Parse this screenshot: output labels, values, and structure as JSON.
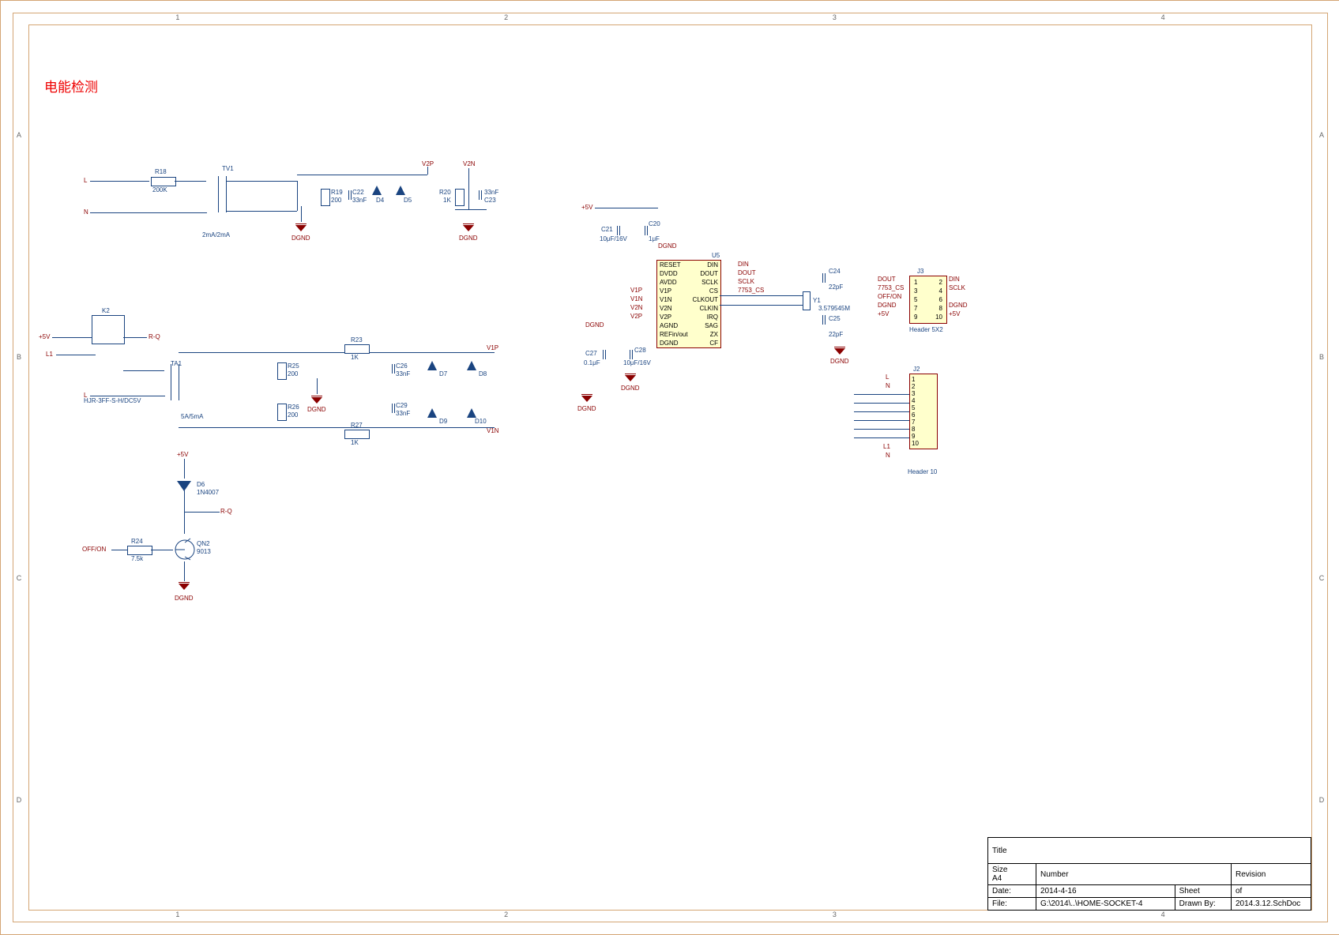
{
  "title_cn": "电能检测",
  "frame": {
    "cols": [
      "1",
      "2",
      "3",
      "4"
    ],
    "rows": [
      "A",
      "B",
      "C",
      "D"
    ]
  },
  "nets": {
    "L": "L",
    "N": "N",
    "L1": "L1",
    "V2P": "V2P",
    "V2N": "V2N",
    "V1P": "V1P",
    "V1N": "V1N",
    "p5V": "+5V",
    "DGND": "DGND",
    "OFFON": "OFF/ON",
    "RQ": "R-Q",
    "DIN": "DIN",
    "DOUT": "DOUT",
    "SCLK": "SCLK",
    "CS7753": "7753_CS"
  },
  "components": {
    "R18": {
      "ref": "R18",
      "val": "200K"
    },
    "R19": {
      "ref": "R19",
      "val": "200"
    },
    "R20": {
      "ref": "R20",
      "val": "1K"
    },
    "R23": {
      "ref": "R23",
      "val": "1K"
    },
    "R24": {
      "ref": "R24",
      "val": "7.5k"
    },
    "R25": {
      "ref": "R25",
      "val": "200"
    },
    "R26": {
      "ref": "R26",
      "val": "200"
    },
    "R27": {
      "ref": "R27",
      "val": "1K"
    },
    "C20": {
      "ref": "C20",
      "val": "1μF"
    },
    "C21": {
      "ref": "C21",
      "val": "10μF/16V"
    },
    "C22": {
      "ref": "C22",
      "val": "33nF"
    },
    "C23": {
      "ref": "C23",
      "val": "33nF"
    },
    "C24": {
      "ref": "C24",
      "val": "22pF"
    },
    "C25": {
      "ref": "C25",
      "val": "22pF"
    },
    "C26": {
      "ref": "C26",
      "val": "33nF"
    },
    "C27": {
      "ref": "C27",
      "val": "0.1μF"
    },
    "C28": {
      "ref": "C28",
      "val": "10μF/16V"
    },
    "C29": {
      "ref": "C29",
      "val": "33nF"
    },
    "D4": "D4",
    "D5": "D5",
    "D6": {
      "ref": "D6",
      "val": "1N4007"
    },
    "D7": "D7",
    "D8": "D8",
    "D9": "D9",
    "D10": "D10",
    "TV1": "TV1",
    "TA1": "TA1",
    "K2": "K2",
    "QN2": {
      "ref": "QN2",
      "val": "9013"
    },
    "Y1": {
      "ref": "Y1",
      "val": "3.579545M"
    },
    "J2": "J2",
    "J3": "J3",
    "U5": "U5",
    "rel": "HJR-3FF-S-H/DC5V",
    "xf1": "2mA/2mA",
    "xf2": "5A/5mA",
    "hdr10": "Header 10",
    "hdr5x2": "Header 5X2"
  },
  "chip_pins": {
    "left": [
      "RESET",
      "DVDD",
      "AVDD",
      "V1P",
      "V1N",
      "V2N",
      "V2P",
      "AGND",
      "REFin/out",
      "DGND"
    ],
    "right": [
      "DIN",
      "DOUT",
      "SCLK",
      "CS",
      "CLKOUT",
      "CLKIN",
      "IRQ",
      "SAG",
      "ZX",
      "CF"
    ]
  },
  "j3_left": [
    "DOUT",
    "7753_CS",
    "OFF/ON",
    "DGND",
    "+5V"
  ],
  "j3_right": [
    "DIN",
    "SCLK",
    "",
    "DGND",
    "+5V"
  ],
  "j2_left": [
    "L",
    "N",
    "",
    "",
    "",
    "",
    "",
    "",
    "L1",
    "N"
  ],
  "titleblock": {
    "title": "Title",
    "size_lbl": "Size",
    "size": "A4",
    "number_lbl": "Number",
    "rev_lbl": "Revision",
    "date_lbl": "Date:",
    "date": "2014-4-16",
    "sheet_lbl": "Sheet",
    "of": "of",
    "file_lbl": "File:",
    "file": "G:\\2014\\..\\HOME-SOCKET-4",
    "drawn_lbl": "Drawn By:",
    "drawn": "2014.3.12.SchDoc"
  }
}
